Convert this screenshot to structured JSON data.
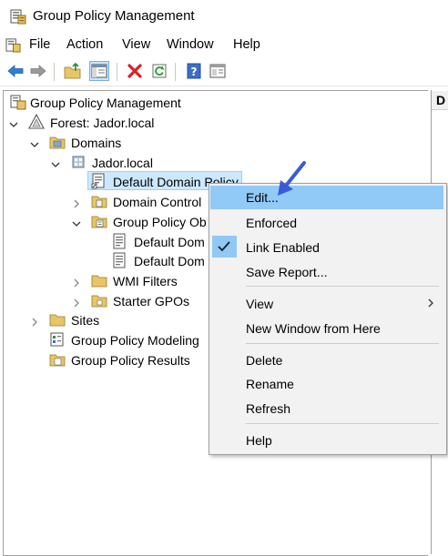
{
  "window": {
    "title": "Group Policy Management"
  },
  "menubar": {
    "items": [
      "File",
      "Action",
      "View",
      "Window",
      "Help"
    ]
  },
  "toolbar": {
    "buttons": [
      "back-icon",
      "forward-icon",
      "up-folder-icon",
      "show-hide-tree-icon",
      "delete-icon",
      "refresh-icon",
      "help-icon",
      "properties-icon"
    ]
  },
  "right_pane": {
    "header": "D"
  },
  "tree": {
    "root": "Group Policy Management",
    "forest": "Forest: Jador.local",
    "domains": "Domains",
    "domain": "Jador.local",
    "default_domain_policy": "Default Domain Policy",
    "domain_controllers": "Domain Control",
    "group_policy_objects": "Group Policy Ob",
    "gpo_1": "Default Dom",
    "gpo_2": "Default Dom",
    "wmi_filters": "WMI Filters",
    "starter_gpos": "Starter GPOs",
    "sites": "Sites",
    "modeling": "Group Policy Modeling",
    "results": "Group Policy Results"
  },
  "context_menu": {
    "edit": "Edit...",
    "enforced": "Enforced",
    "link_enabled": "Link Enabled",
    "link_enabled_checked": true,
    "save_report": "Save Report...",
    "view": "View",
    "new_window": "New Window from Here",
    "delete": "Delete",
    "rename": "Rename",
    "refresh": "Refresh",
    "help": "Help"
  },
  "colors": {
    "selection": "#cce8ff",
    "menu_highlight": "#91c9f7",
    "annotation_arrow": "#3a5bd9",
    "delete_red": "#d9202a"
  }
}
